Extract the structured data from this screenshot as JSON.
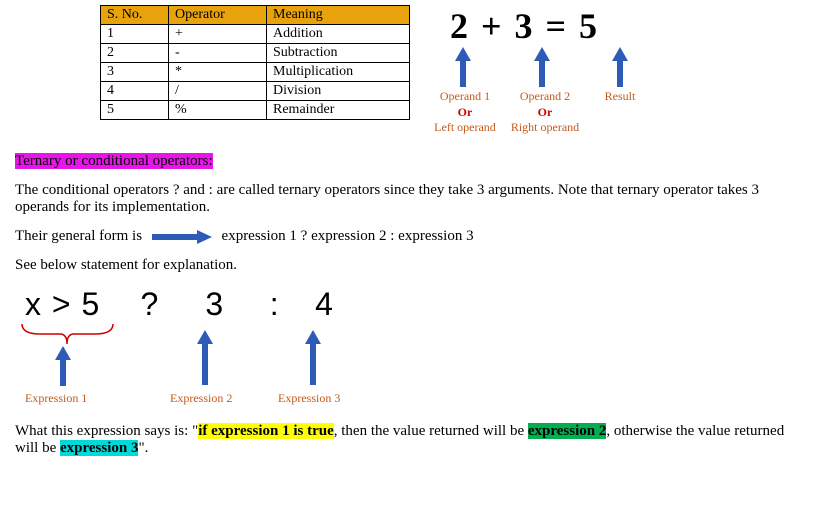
{
  "table": {
    "headers": [
      "S. No.",
      "Operator",
      "Meaning"
    ],
    "rows": [
      [
        "1",
        "+",
        "Addition"
      ],
      [
        "2",
        "-",
        "Subtraction"
      ],
      [
        "3",
        "*",
        "Multiplication"
      ],
      [
        "4",
        "/",
        "Division"
      ],
      [
        "5",
        "%",
        "Remainder"
      ]
    ]
  },
  "equation": {
    "text": "2 + 3 = 5",
    "labels": {
      "operand1": "Operand 1",
      "operand1_alt": "Left operand",
      "operand2": "Operand 2",
      "operand2_alt": "Right operand",
      "result": "Result",
      "or": "Or"
    }
  },
  "heading": "Ternary or conditional operators:",
  "para1": "The conditional operators ? and : are called ternary operators since they take 3 arguments. Note that ternary operator takes 3 operands for its implementation.",
  "general_form_prefix": "Their general form is",
  "general_form_expr": "expression 1 ? expression 2 : expression 3",
  "see_below": "See below statement for explanation.",
  "ternary": {
    "expr_parts": [
      "x > 5",
      "?",
      "3",
      ":",
      "4"
    ],
    "labels": [
      "Expression 1",
      "Expression 2",
      "Expression 3"
    ]
  },
  "final": {
    "prefix": "What this expression says is: \"",
    "hl1": "if expression 1 is true",
    "mid1": ", then the value returned will be ",
    "hl2": "expression 2",
    "mid2": ", otherwise the value returned will be ",
    "hl3": "expression 3",
    "suffix": "\"."
  }
}
